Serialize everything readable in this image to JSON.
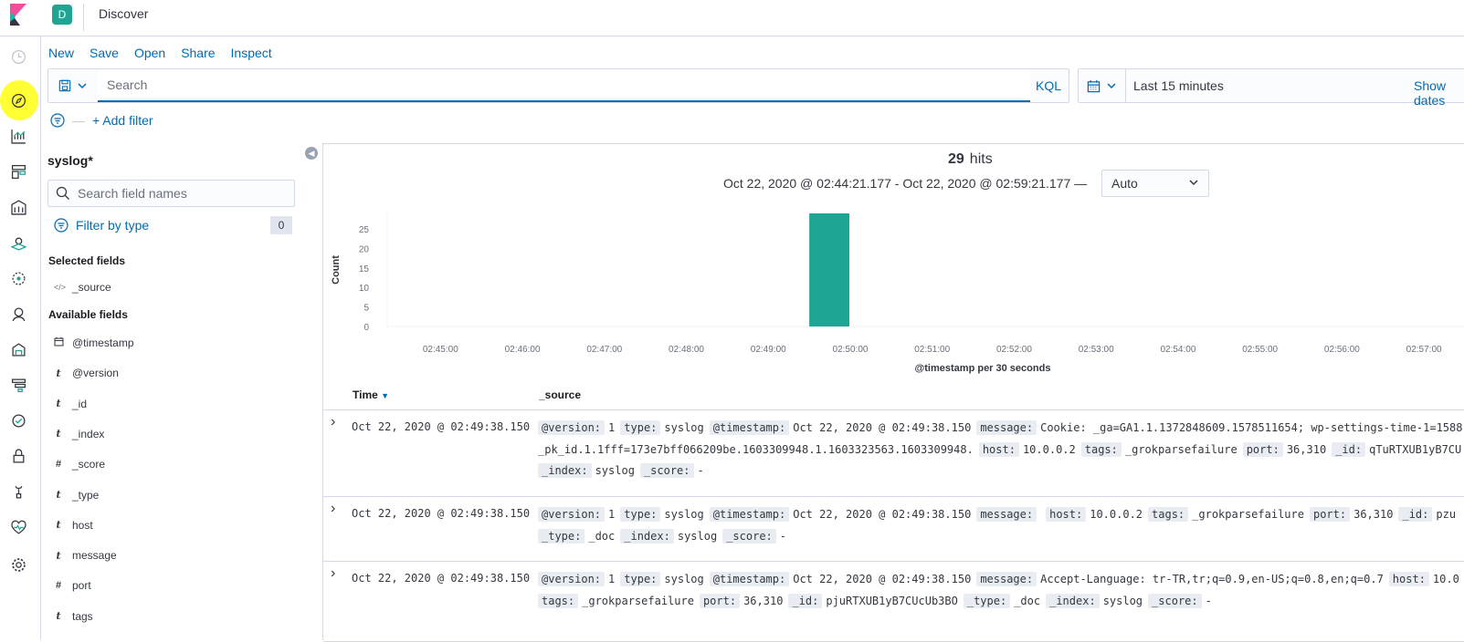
{
  "header": {
    "space_initial": "D",
    "app_title": "Discover"
  },
  "topnav": {
    "new": "New",
    "save": "Save",
    "open": "Open",
    "share": "Share",
    "inspect": "Inspect"
  },
  "querybar": {
    "placeholder": "Search",
    "language": "KQL"
  },
  "timepicker": {
    "range": "Last 15 minutes",
    "show_dates": "Show dates"
  },
  "filters": {
    "add_filter": "+ Add filter"
  },
  "sidebar": {
    "index_pattern": "syslog*",
    "field_search_placeholder": "Search field names",
    "filter_by_type": "Filter by type",
    "filter_count": "0",
    "selected_title": "Selected fields",
    "selected_fields": [
      {
        "type": "source",
        "name": "_source"
      }
    ],
    "available_title": "Available fields",
    "available_fields": [
      {
        "type": "date",
        "name": "@timestamp"
      },
      {
        "type": "t",
        "name": "@version"
      },
      {
        "type": "t",
        "name": "_id"
      },
      {
        "type": "t",
        "name": "_index"
      },
      {
        "type": "#",
        "name": "_score"
      },
      {
        "type": "t",
        "name": "_type"
      },
      {
        "type": "t",
        "name": "host"
      },
      {
        "type": "t",
        "name": "message"
      },
      {
        "type": "#",
        "name": "port"
      },
      {
        "type": "t",
        "name": "tags"
      }
    ]
  },
  "results": {
    "hits_count": "29",
    "hits_label": "hits",
    "date_range": "Oct 22, 2020 @ 02:44:21.177 - Oct 22, 2020 @ 02:59:21.177 —",
    "interval": "Auto"
  },
  "chart_data": {
    "type": "bar",
    "title": "",
    "xlabel": "@timestamp per 30 seconds",
    "ylabel": "Count",
    "ylim": [
      0,
      29
    ],
    "yticks": [
      0,
      5,
      10,
      15,
      20,
      25
    ],
    "x_ticks": [
      "02:45:00",
      "02:46:00",
      "02:47:00",
      "02:48:00",
      "02:49:00",
      "02:50:00",
      "02:51:00",
      "02:52:00",
      "02:53:00",
      "02:54:00",
      "02:55:00",
      "02:56:00",
      "02:57:00"
    ],
    "bars": [
      {
        "start": "02:49:30",
        "end": "02:50:00",
        "value": 29
      }
    ],
    "bar_color": "#1ea593",
    "grid": false
  },
  "table": {
    "col_time": "Time",
    "col_source": "_source",
    "rows": [
      {
        "time": "Oct 22, 2020 @ 02:49:38.150",
        "lines": [
          [
            [
              "@version:",
              "1"
            ],
            [
              "type:",
              "syslog"
            ],
            [
              "@timestamp:",
              "Oct 22, 2020 @ 02:49:38.150"
            ],
            [
              "message:",
              "Cookie: _ga=GA1.1.1372848609.1578511654; wp-settings-time-1=1588"
            ]
          ],
          [
            [
              "",
              "_pk_id.1.1fff=173e7bff066209be.1603309948.1.1603323563.1603309948."
            ],
            [
              "host:",
              "10.0.0.2"
            ],
            [
              "tags:",
              "_grokparsefailure"
            ],
            [
              "port:",
              "36,310"
            ],
            [
              "_id:",
              "qTuRTXUB1yB7CU"
            ]
          ],
          [
            [
              "_index:",
              "syslog"
            ],
            [
              "_score:",
              "-"
            ]
          ]
        ]
      },
      {
        "time": "Oct 22, 2020 @ 02:49:38.150",
        "lines": [
          [
            [
              "@version:",
              "1"
            ],
            [
              "type:",
              "syslog"
            ],
            [
              "@timestamp:",
              "Oct 22, 2020 @ 02:49:38.150"
            ],
            [
              "message:",
              ""
            ],
            [
              "host:",
              "10.0.0.2"
            ],
            [
              "tags:",
              "_grokparsefailure"
            ],
            [
              "port:",
              "36,310"
            ],
            [
              "_id:",
              "pzu"
            ]
          ],
          [
            [
              "_type:",
              "_doc"
            ],
            [
              "_index:",
              "syslog"
            ],
            [
              "_score:",
              "-"
            ]
          ]
        ]
      },
      {
        "time": "Oct 22, 2020 @ 02:49:38.150",
        "lines": [
          [
            [
              "@version:",
              "1"
            ],
            [
              "type:",
              "syslog"
            ],
            [
              "@timestamp:",
              "Oct 22, 2020 @ 02:49:38.150"
            ],
            [
              "message:",
              "Accept-Language: tr-TR,tr;q=0.9,en-US;q=0.8,en;q=0.7"
            ],
            [
              "host:",
              "10.0"
            ]
          ],
          [
            [
              "tags:",
              "_grokparsefailure"
            ],
            [
              "port:",
              "36,310"
            ],
            [
              "_id:",
              "pjuRTXUB1yB7CUcUb3BO"
            ],
            [
              "_type:",
              "_doc"
            ],
            [
              "_index:",
              "syslog"
            ],
            [
              "_score:",
              "-"
            ]
          ]
        ]
      }
    ]
  }
}
